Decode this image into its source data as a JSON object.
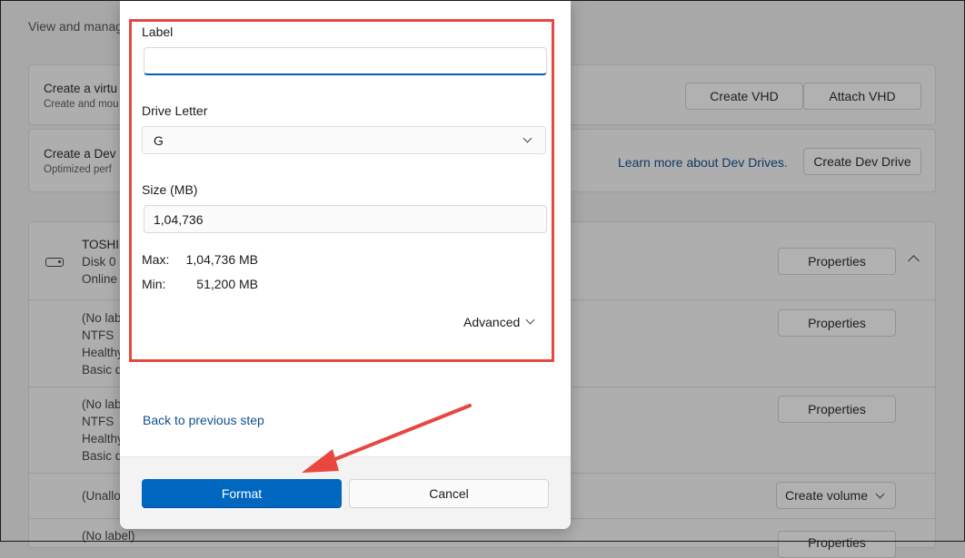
{
  "background": {
    "subtitle": "View and manag",
    "cards": [
      {
        "title": "Create a virtu",
        "desc": "Create and mou",
        "buttons": [
          "Create VHD",
          "Attach VHD"
        ]
      },
      {
        "title": "Create a Dev",
        "desc": "Optimized perf",
        "link": "Learn more about Dev Drives.",
        "buttons": [
          "Create Dev Drive"
        ]
      }
    ],
    "disk": {
      "name": "TOSHIE",
      "disk": "Disk 0",
      "status": "Online",
      "button": "Properties"
    },
    "volumes": [
      {
        "lines": [
          "(No labe",
          "NTFS",
          "Healthy",
          "Basic d"
        ],
        "button": "Properties"
      },
      {
        "lines": [
          "(No lab",
          "NTFS",
          "Healthy",
          "Basic d"
        ],
        "button": "Properties"
      },
      {
        "lines": [
          "(Unallo"
        ],
        "button": "Create volume"
      },
      {
        "lines": [
          "(No label)"
        ],
        "button": "Properties"
      }
    ]
  },
  "dialog": {
    "label_field": {
      "label": "Label",
      "value": ""
    },
    "drive_letter": {
      "label": "Drive Letter",
      "value": "G"
    },
    "size": {
      "label": "Size (MB)",
      "value": "1,04,736"
    },
    "max": {
      "label": "Max:",
      "value": "1,04,736 MB"
    },
    "min": {
      "label": "Min:",
      "value": "51,200 MB"
    },
    "advanced": "Advanced",
    "back_link": "Back to previous step",
    "format_button": "Format",
    "cancel_button": "Cancel"
  },
  "colors": {
    "accent": "#0067c0",
    "annotation": "#e8473f",
    "link": "#0f4f8f"
  }
}
